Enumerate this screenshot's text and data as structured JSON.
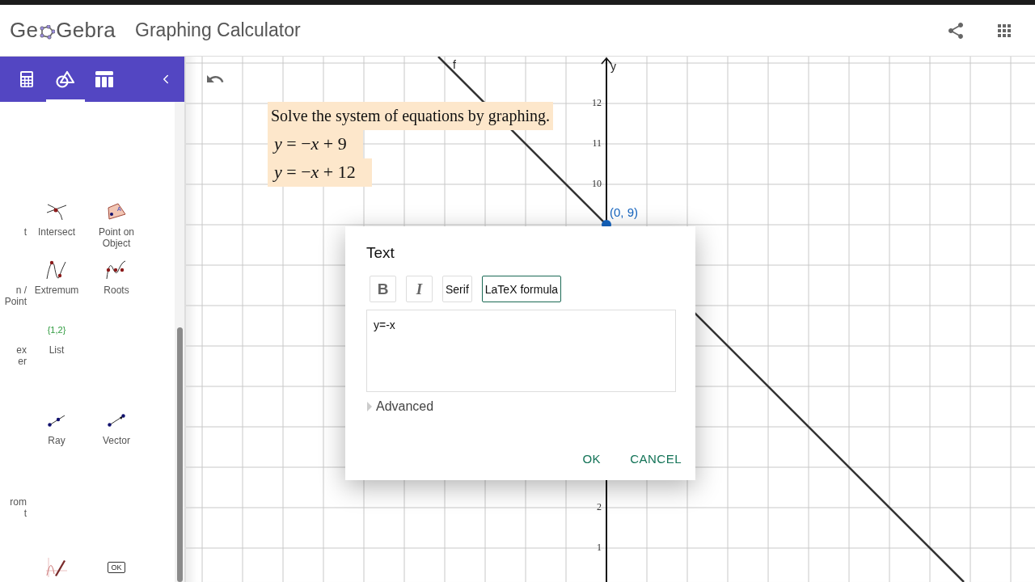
{
  "header": {
    "logo": {
      "before": "Ge",
      "after": "Gebra"
    },
    "title": "Graphing Calculator"
  },
  "sidebar": {
    "tabs": [
      {
        "kind": "calculator",
        "selected": false
      },
      {
        "kind": "geometry",
        "selected": true
      },
      {
        "kind": "table",
        "selected": false
      }
    ],
    "tool_rows": [
      [
        {
          "kind": "blank",
          "label": "t"
        },
        {
          "kind": "intersect",
          "label": "Intersect"
        },
        {
          "kind": "point-on-object",
          "icon_text": "A",
          "label": "Point on Object"
        }
      ],
      [
        {
          "kind": "blank",
          "label": "n /\nPoint"
        },
        {
          "kind": "extremum",
          "label": "Extremum"
        },
        {
          "kind": "roots",
          "label": "Roots"
        }
      ],
      [
        {
          "kind": "blank",
          "label": "ex\ner"
        },
        {
          "kind": "list",
          "icon_text": "{1,2}",
          "label": "List"
        }
      ],
      [
        {
          "kind": "blank"
        },
        {
          "kind": "ray",
          "label": "Ray"
        },
        {
          "kind": "vector",
          "label": "Vector"
        }
      ],
      [
        {
          "kind": "blank",
          "label": "rom\nt"
        }
      ],
      [
        {
          "kind": "blank"
        },
        {
          "kind": "freehand"
        },
        {
          "kind": "button-tool",
          "icon_text": "OK"
        }
      ]
    ]
  },
  "graph": {
    "function_label": "f",
    "axis_label": "y",
    "y_ticks": [
      "12",
      "11",
      "10",
      "2",
      "1"
    ],
    "point": {
      "label": "(0, 9)"
    }
  },
  "text_box": {
    "title": "Solve the system of equations by graphing.",
    "equations": [
      "*y* = −*x* + 9",
      "*y* = −*x* + 12"
    ]
  },
  "dialog": {
    "title": "Text",
    "format_buttons": [
      {
        "kind": "bold",
        "label": "B",
        "selected": false
      },
      {
        "kind": "italic",
        "label": "I",
        "selected": false
      },
      {
        "kind": "serif",
        "label": "Serif",
        "selected": false
      },
      {
        "kind": "latex",
        "label": "LaTeX formula",
        "selected": true
      }
    ],
    "value": "y=-x",
    "advanced": {
      "label": "Advanced",
      "expanded": false
    },
    "buttons": [
      "OK",
      "CANCEL"
    ]
  }
}
